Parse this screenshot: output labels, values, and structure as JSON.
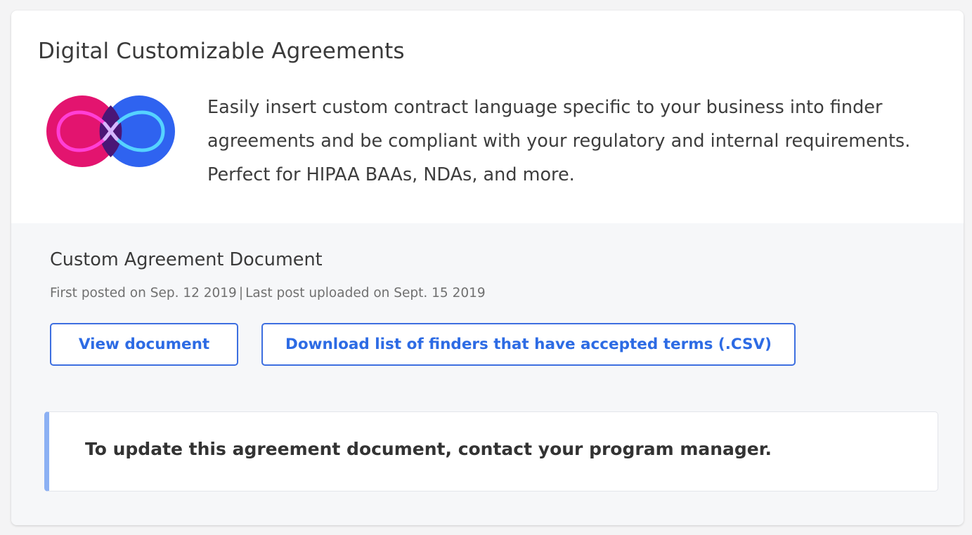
{
  "card": {
    "title": "Digital Customizable Agreements",
    "description": "Easily insert custom contract language specific to your business into finder agreements and be compliant with your regulatory and internal requirements. Perfect for HIPAA BAAs, NDAs, and more.",
    "logo_icon": "infinity-logo-icon"
  },
  "document": {
    "title": "Custom Agreement Document",
    "first_posted": "First posted on Sep. 12 2019",
    "separator": "|",
    "last_uploaded": "Last post uploaded on Sept. 15 2019",
    "view_button_label": "View document",
    "download_button_label": "Download list of finders that have accepted terms  (.CSV)"
  },
  "notice": {
    "text": "To update this agreement document, contact your program manager."
  },
  "colors": {
    "accent": "#2d6be4",
    "logo_pink": "#e3146f",
    "logo_blue": "#2f63f0",
    "notice_border": "#8cb0f3"
  }
}
